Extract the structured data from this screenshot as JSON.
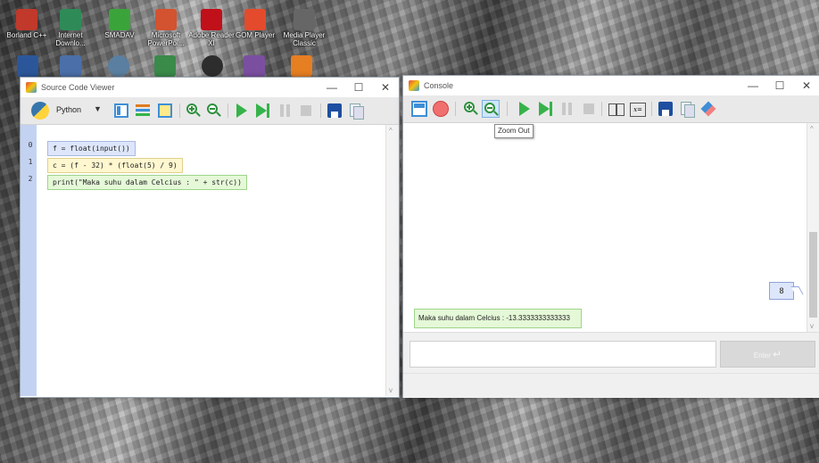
{
  "desktop": {
    "icons_row1": [
      "Borland C++",
      "Internet Downlo...",
      "SMADAV",
      "Microsoft PowerPoi...",
      "Adobe Reader XI",
      "GOM Player",
      "Media Player Classic"
    ]
  },
  "source_viewer": {
    "title": "Source Code Viewer",
    "language": "Python",
    "controls": {
      "minimize": "—",
      "maximize": "☐",
      "close": "✕"
    },
    "lines": [
      {
        "num": "0",
        "code": "f = float(input())"
      },
      {
        "num": "1",
        "code": "c = (f - 32) * (float(5) / 9)"
      },
      {
        "num": "2",
        "code": "print(\"Maka suhu dalam Celcius : \" + str(c))"
      }
    ]
  },
  "console": {
    "title": "Console",
    "controls": {
      "minimize": "—",
      "maximize": "☐",
      "close": "✕"
    },
    "tooltip": "Zoom Out",
    "input_bubble": "8",
    "output_bubble": "Maka suhu dalam Celcius : -13.3333333333333",
    "input_placeholder": "",
    "enter_label": "Enter"
  },
  "colors": {
    "line0": "#dde6fb",
    "line1": "#fff7cf",
    "line2": "#e5f8d8",
    "gutter": "#c4d2f2",
    "accent": "#35b34a"
  }
}
